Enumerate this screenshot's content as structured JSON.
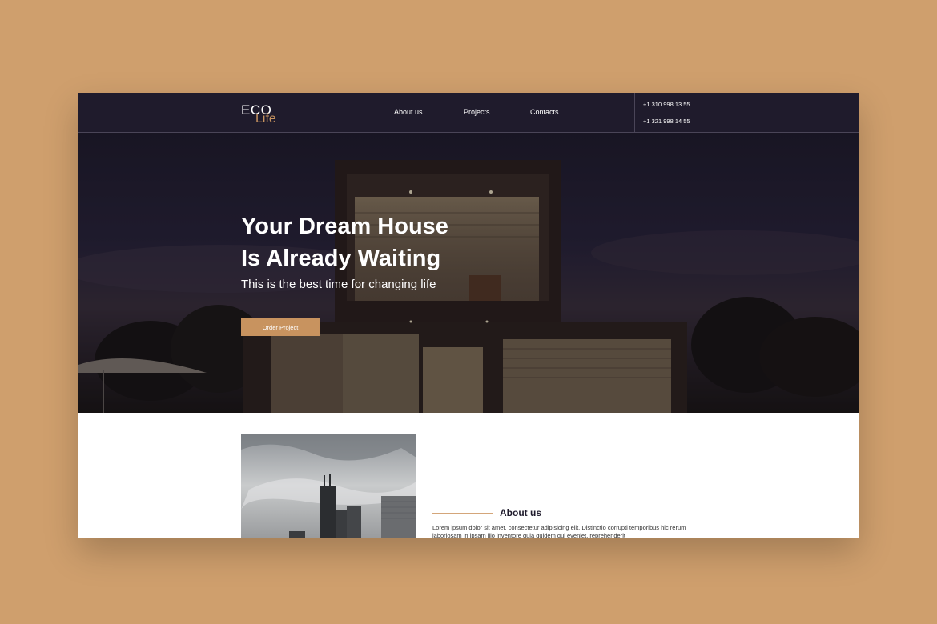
{
  "logo": {
    "line1": "ECO",
    "line2": "Life"
  },
  "nav": [
    {
      "label": "About us"
    },
    {
      "label": "Projects"
    },
    {
      "label": "Contacts"
    }
  ],
  "contacts": {
    "phone1": "+1 310 998 13 55",
    "phone2": "+1 321 998 14 55"
  },
  "hero": {
    "title_line1": "Your Dream House",
    "title_line2": "Is Already Waiting",
    "subtitle": "This is the best time for changing life",
    "button": "Order Project"
  },
  "about": {
    "title": "About us",
    "text": "Lorem ipsum dolor sit amet, consectetur adipisicing elit. Distinctio corrupti temporibus hic rerum laboriosam in ipsam illo inventore quia quidem qui eveniet, reprehenderit"
  },
  "colors": {
    "background": "#cf9f6d",
    "header": "#1f1b2c",
    "accent": "#c8935f"
  }
}
